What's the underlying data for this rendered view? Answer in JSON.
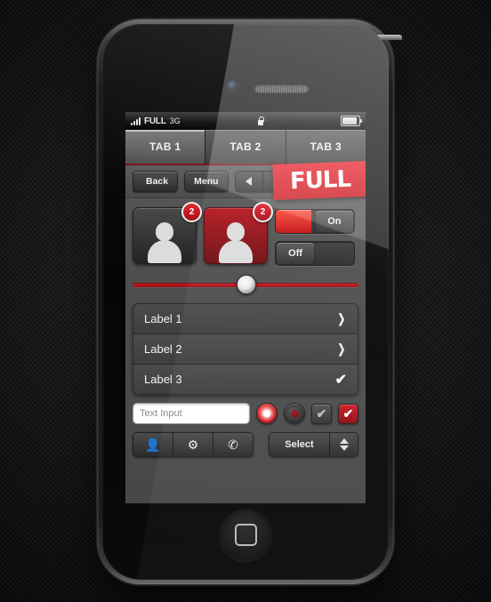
{
  "device": {
    "name": "smartphone-mockup",
    "home_button_icon": "rounded-square-icon",
    "camera_icon": "front-camera-icon",
    "speaker_icon": "earpiece-speaker-icon"
  },
  "statusbar": {
    "signal_icon": "signal-bars-icon",
    "carrier": "FULL",
    "network": "3G",
    "lock_icon": "lock-icon",
    "battery_icon": "battery-icon"
  },
  "tabs": [
    {
      "label": "TAB 1",
      "active": true
    },
    {
      "label": "TAB 2",
      "active": false
    },
    {
      "label": "TAB 3",
      "active": false
    }
  ],
  "toolbar": {
    "back_label": "Back",
    "menu_label": "Menu",
    "prev_icon": "triangle-left-icon",
    "next_icon": "triangle-right-icon",
    "logo_text": "FULL"
  },
  "media": {
    "tiles": [
      {
        "icon": "person-avatar-icon",
        "badge": "2",
        "state": "normal"
      },
      {
        "icon": "person-avatar-icon",
        "badge": "2",
        "state": "selected"
      }
    ],
    "switches": [
      {
        "label": "On",
        "state": "on"
      },
      {
        "label": "Off",
        "state": "off"
      }
    ]
  },
  "slider": {
    "name": "volume-slider",
    "value_percent": 50
  },
  "list": [
    {
      "label": "Label 1",
      "accessory": "chevron-right-icon",
      "glyph": "❯"
    },
    {
      "label": "Label 2",
      "accessory": "chevron-right-icon",
      "glyph": "❯"
    },
    {
      "label": "Label 3",
      "accessory": "checkmark-icon",
      "glyph": "✔"
    }
  ],
  "form": {
    "text_input_value": "Text Input",
    "text_input_placeholder": "Text Input",
    "radio_selected_icon": "radio-selected-icon",
    "radio_unselected_icon": "radio-unselected-icon",
    "checkbox_unchecked_icon": "checkbox-unchecked-icon",
    "checkbox_checked_icon": "checkbox-checked-icon",
    "checkbox_unchecked_glyph": "✔",
    "checkbox_checked_glyph": "✔"
  },
  "bottom": {
    "icons": [
      {
        "name": "person-icon",
        "glyph": "👤"
      },
      {
        "name": "gear-icon",
        "glyph": "⚙"
      },
      {
        "name": "phone-icon",
        "glyph": "✆"
      }
    ],
    "select_label": "Select",
    "stepper_icon": "up-down-stepper-icon"
  },
  "colors": {
    "accent_red": "#cc1018",
    "accent_red_light": "#ff4b3a",
    "chrome_dark": "#2c2c2c",
    "screen_bg": "#4e4e4e"
  }
}
